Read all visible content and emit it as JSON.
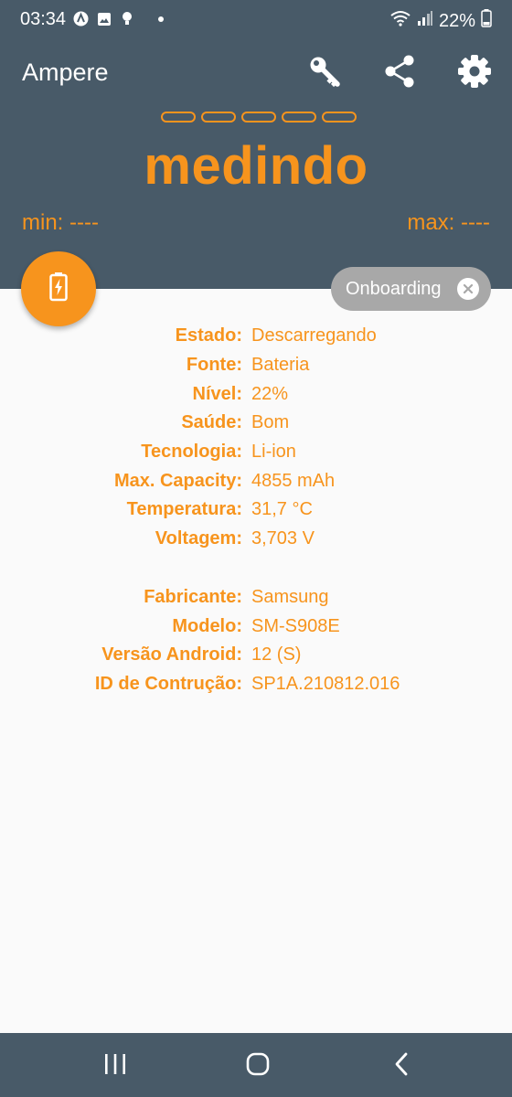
{
  "status_bar": {
    "time": "03:34",
    "battery_percent": "22%",
    "notification_icons": [
      "accessibility-icon",
      "gallery-icon",
      "bulb-icon",
      "dot-icon"
    ]
  },
  "toolbar": {
    "title": "Ampere",
    "actions": [
      "key-icon",
      "share-icon",
      "gear-icon"
    ]
  },
  "meter": {
    "status": "medindo",
    "min_label": "min: ----",
    "max_label": "max: ----"
  },
  "onboarding_chip": {
    "label": "Onboarding"
  },
  "battery_info": [
    {
      "label": "Estado:",
      "value": "Descarregando"
    },
    {
      "label": "Fonte:",
      "value": "Bateria"
    },
    {
      "label": "Nível:",
      "value": "22%"
    },
    {
      "label": "Saúde:",
      "value": "Bom"
    },
    {
      "label": "Tecnologia:",
      "value": "Li-ion"
    },
    {
      "label": "Max. Capacity:",
      "value": "4855 mAh"
    },
    {
      "label": "Temperatura:",
      "value": "31,7 °C"
    },
    {
      "label": "Voltagem:",
      "value": "3,703 V"
    }
  ],
  "device_info": [
    {
      "label": "Fabricante:",
      "value": "Samsung"
    },
    {
      "label": "Modelo:",
      "value": "SM-S908E"
    },
    {
      "label": "Versão Android:",
      "value": "12 (S)"
    },
    {
      "label": "ID de Contrução:",
      "value": "SP1A.210812.016"
    }
  ],
  "colors": {
    "accent": "#f7941d",
    "header": "#485a68",
    "chip": "#a8a8a8",
    "background": "#fafafa"
  }
}
